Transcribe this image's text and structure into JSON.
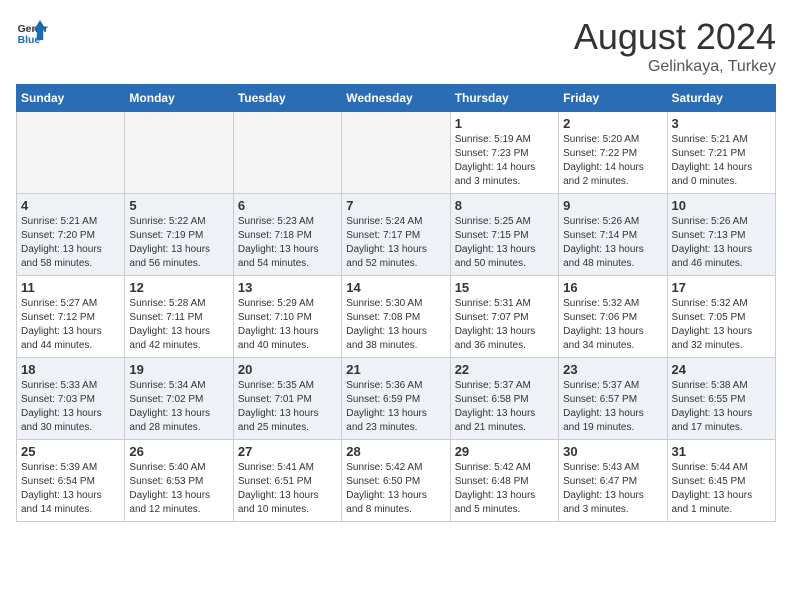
{
  "logo": {
    "line1": "General",
    "line2": "Blue"
  },
  "title": "August 2024",
  "subtitle": "Gelinkaya, Turkey",
  "days_of_week": [
    "Sunday",
    "Monday",
    "Tuesday",
    "Wednesday",
    "Thursday",
    "Friday",
    "Saturday"
  ],
  "weeks": [
    [
      {
        "day": "",
        "info": ""
      },
      {
        "day": "",
        "info": ""
      },
      {
        "day": "",
        "info": ""
      },
      {
        "day": "",
        "info": ""
      },
      {
        "day": "1",
        "info": "Sunrise: 5:19 AM\nSunset: 7:23 PM\nDaylight: 14 hours\nand 3 minutes."
      },
      {
        "day": "2",
        "info": "Sunrise: 5:20 AM\nSunset: 7:22 PM\nDaylight: 14 hours\nand 2 minutes."
      },
      {
        "day": "3",
        "info": "Sunrise: 5:21 AM\nSunset: 7:21 PM\nDaylight: 14 hours\nand 0 minutes."
      }
    ],
    [
      {
        "day": "4",
        "info": "Sunrise: 5:21 AM\nSunset: 7:20 PM\nDaylight: 13 hours\nand 58 minutes."
      },
      {
        "day": "5",
        "info": "Sunrise: 5:22 AM\nSunset: 7:19 PM\nDaylight: 13 hours\nand 56 minutes."
      },
      {
        "day": "6",
        "info": "Sunrise: 5:23 AM\nSunset: 7:18 PM\nDaylight: 13 hours\nand 54 minutes."
      },
      {
        "day": "7",
        "info": "Sunrise: 5:24 AM\nSunset: 7:17 PM\nDaylight: 13 hours\nand 52 minutes."
      },
      {
        "day": "8",
        "info": "Sunrise: 5:25 AM\nSunset: 7:15 PM\nDaylight: 13 hours\nand 50 minutes."
      },
      {
        "day": "9",
        "info": "Sunrise: 5:26 AM\nSunset: 7:14 PM\nDaylight: 13 hours\nand 48 minutes."
      },
      {
        "day": "10",
        "info": "Sunrise: 5:26 AM\nSunset: 7:13 PM\nDaylight: 13 hours\nand 46 minutes."
      }
    ],
    [
      {
        "day": "11",
        "info": "Sunrise: 5:27 AM\nSunset: 7:12 PM\nDaylight: 13 hours\nand 44 minutes."
      },
      {
        "day": "12",
        "info": "Sunrise: 5:28 AM\nSunset: 7:11 PM\nDaylight: 13 hours\nand 42 minutes."
      },
      {
        "day": "13",
        "info": "Sunrise: 5:29 AM\nSunset: 7:10 PM\nDaylight: 13 hours\nand 40 minutes."
      },
      {
        "day": "14",
        "info": "Sunrise: 5:30 AM\nSunset: 7:08 PM\nDaylight: 13 hours\nand 38 minutes."
      },
      {
        "day": "15",
        "info": "Sunrise: 5:31 AM\nSunset: 7:07 PM\nDaylight: 13 hours\nand 36 minutes."
      },
      {
        "day": "16",
        "info": "Sunrise: 5:32 AM\nSunset: 7:06 PM\nDaylight: 13 hours\nand 34 minutes."
      },
      {
        "day": "17",
        "info": "Sunrise: 5:32 AM\nSunset: 7:05 PM\nDaylight: 13 hours\nand 32 minutes."
      }
    ],
    [
      {
        "day": "18",
        "info": "Sunrise: 5:33 AM\nSunset: 7:03 PM\nDaylight: 13 hours\nand 30 minutes."
      },
      {
        "day": "19",
        "info": "Sunrise: 5:34 AM\nSunset: 7:02 PM\nDaylight: 13 hours\nand 28 minutes."
      },
      {
        "day": "20",
        "info": "Sunrise: 5:35 AM\nSunset: 7:01 PM\nDaylight: 13 hours\nand 25 minutes."
      },
      {
        "day": "21",
        "info": "Sunrise: 5:36 AM\nSunset: 6:59 PM\nDaylight: 13 hours\nand 23 minutes."
      },
      {
        "day": "22",
        "info": "Sunrise: 5:37 AM\nSunset: 6:58 PM\nDaylight: 13 hours\nand 21 minutes."
      },
      {
        "day": "23",
        "info": "Sunrise: 5:37 AM\nSunset: 6:57 PM\nDaylight: 13 hours\nand 19 minutes."
      },
      {
        "day": "24",
        "info": "Sunrise: 5:38 AM\nSunset: 6:55 PM\nDaylight: 13 hours\nand 17 minutes."
      }
    ],
    [
      {
        "day": "25",
        "info": "Sunrise: 5:39 AM\nSunset: 6:54 PM\nDaylight: 13 hours\nand 14 minutes."
      },
      {
        "day": "26",
        "info": "Sunrise: 5:40 AM\nSunset: 6:53 PM\nDaylight: 13 hours\nand 12 minutes."
      },
      {
        "day": "27",
        "info": "Sunrise: 5:41 AM\nSunset: 6:51 PM\nDaylight: 13 hours\nand 10 minutes."
      },
      {
        "day": "28",
        "info": "Sunrise: 5:42 AM\nSunset: 6:50 PM\nDaylight: 13 hours\nand 8 minutes."
      },
      {
        "day": "29",
        "info": "Sunrise: 5:42 AM\nSunset: 6:48 PM\nDaylight: 13 hours\nand 5 minutes."
      },
      {
        "day": "30",
        "info": "Sunrise: 5:43 AM\nSunset: 6:47 PM\nDaylight: 13 hours\nand 3 minutes."
      },
      {
        "day": "31",
        "info": "Sunrise: 5:44 AM\nSunset: 6:45 PM\nDaylight: 13 hours\nand 1 minute."
      }
    ]
  ]
}
